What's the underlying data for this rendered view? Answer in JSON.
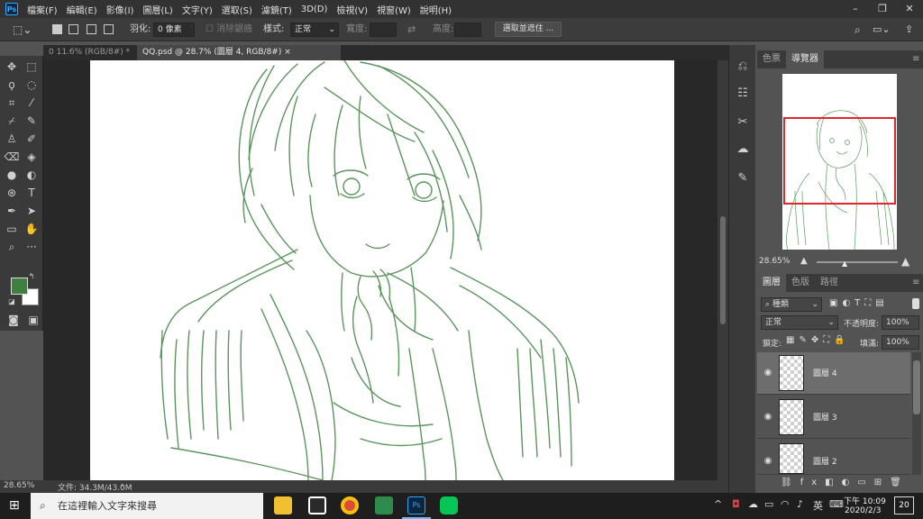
{
  "app": {
    "logo": "Ps"
  },
  "menu": [
    "檔案(F)",
    "編輯(E)",
    "影像(I)",
    "圖層(L)",
    "文字(Y)",
    "選取(S)",
    "濾鏡(T)",
    "3D(D)",
    "檢視(V)",
    "視窗(W)",
    "說明(H)"
  ],
  "window_controls": {
    "minimize": "–",
    "restore": "❐",
    "close": "✕"
  },
  "options": {
    "feather_label": "羽化:",
    "feather_value": "0 像素",
    "antialias_label": "消除鋸齒",
    "style_label": "樣式:",
    "style_value": "正常",
    "width_label": "寬度:",
    "height_label": "高度:",
    "select_mask_button": "選取並遮住 ..."
  },
  "tabs": [
    {
      "label": "0 11.6% (RGB/8#) *",
      "active": false
    },
    {
      "label": "QQ.psd @ 28.7% (圖層 4, RGB/8#)",
      "active": true
    }
  ],
  "tab_close": "×",
  "status": {
    "zoom": "28.65%",
    "doc_info": "文件: 34.3M/43.0M"
  },
  "navigator": {
    "tabs": [
      "色票",
      "導覽器"
    ],
    "active_tab": "導覽器",
    "zoom": "28.65%"
  },
  "layers_panel": {
    "tabs": [
      "圖層",
      "色版",
      "路徑"
    ],
    "active_tab": "圖層",
    "filter_kind": "種類",
    "blend_mode": "正常",
    "opacity_label": "不透明度:",
    "opacity_value": "100%",
    "lock_label": "鎖定:",
    "fill_label": "填滿:",
    "fill_value": "100%",
    "layers": [
      {
        "name": "圖層 4",
        "selected": true
      },
      {
        "name": "圖層 3",
        "selected": false
      },
      {
        "name": "圖層 2",
        "selected": false
      }
    ]
  },
  "colors": {
    "foreground": "#3f7f3f",
    "background": "#ffffff",
    "sketch_stroke": "#4a8a4a",
    "nav_frame": "#e0282c"
  },
  "taskbar": {
    "search_placeholder": "在這裡輸入文字來搜尋",
    "time": "下午 10:09",
    "date": "2020/2/3",
    "ime": "英",
    "notification_count": "20"
  }
}
